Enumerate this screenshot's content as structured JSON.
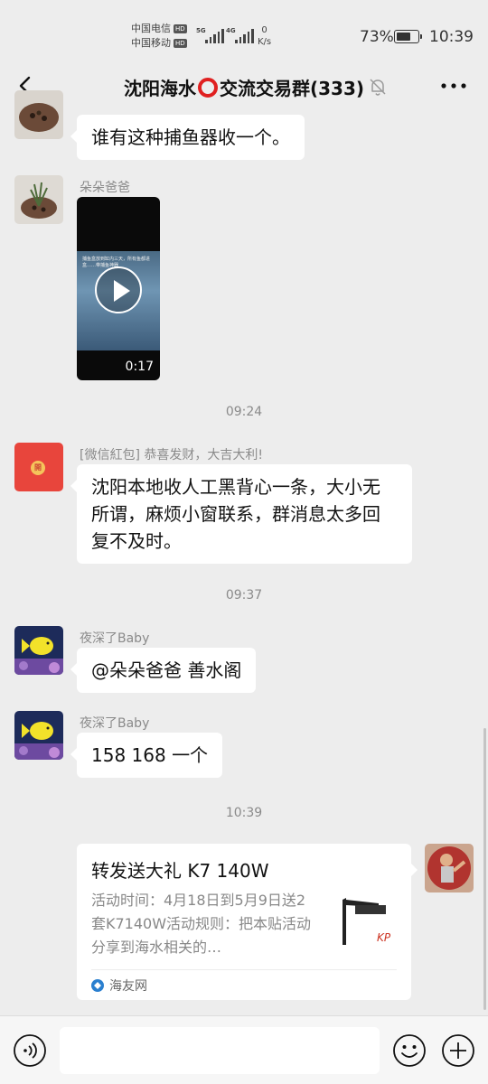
{
  "status_bar": {
    "carrier_1": "中国电信",
    "carrier_2": "中国移动",
    "hd": "HD",
    "signal_1": "5G",
    "signal_2": "4G",
    "net_speed_value": "0",
    "net_speed_unit": "K/s",
    "battery_percent": "73%",
    "battery_level": 0.73,
    "time": "10:39"
  },
  "header": {
    "title_left": "沈阳海水",
    "title_right": "交流交易群(333)"
  },
  "messages": {
    "m1": {
      "text": "谁有这种捕鱼器收一个。"
    },
    "m2": {
      "sender": "朵朵爸爸",
      "video_duration": "0:17",
      "video_overlay_text": "捕鱼盒放到缸内三天，所有鱼都进盒……带捕鱼神器"
    },
    "t1": "09:24",
    "m3": {
      "sender": "[微信紅包] 恭喜发财，大吉大利!",
      "redpacket_coin": "開",
      "text": "沈阳本地收人工黑背心一条，大小无所谓，麻烦小窗联系，群消息太多回复不及时。"
    },
    "t2": "09:37",
    "m4": {
      "sender": "夜深了Baby",
      "text": "@朵朵爸爸  善水阁"
    },
    "m5": {
      "sender": "夜深了Baby",
      "text": "158 168 一个"
    },
    "t3": "10:39",
    "m6": {
      "card_title": "转发送大礼 K7 140W",
      "card_desc": "活动时间：4月18日到5月9日送2套K7140W活动规则：把本贴活动分享到海水相关的…",
      "card_source": "海友网",
      "thumb_brand": "KP"
    }
  },
  "colors": {
    "background": "#ededed",
    "bubble": "#ffffff",
    "redpacket": "#e8453c",
    "accent_red": "#e02020"
  },
  "icons": {
    "back": "chevron-left-icon",
    "mute": "bell-off-icon",
    "more": "more-dots-icon",
    "voice": "voice-icon",
    "emoji": "emoji-icon",
    "plus": "plus-icon"
  }
}
